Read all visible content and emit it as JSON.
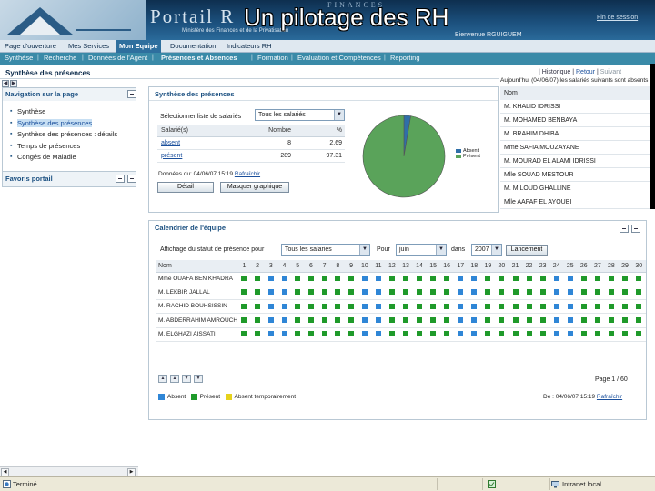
{
  "slide_title": "Un pilotage des RH",
  "banner": {
    "finances": "FINANCES",
    "portal_name": "Portail R",
    "ministry": "Ministère des Finances et de la Privatisation",
    "welcome": "Bienvenue RGUIGUEM",
    "logout": "Fin de session"
  },
  "nav_main": [
    {
      "label": "Page d'ouverture"
    },
    {
      "label": "Mes Services"
    },
    {
      "label": "Mon Equipe",
      "active": true
    },
    {
      "label": "Documentation"
    },
    {
      "label": "Indicateurs RH"
    }
  ],
  "nav_sub": [
    {
      "label": "Synthèse"
    },
    {
      "label": "Recherche"
    },
    {
      "label": "Données de l'Agent"
    },
    {
      "label": "Présences et Absences",
      "active": true
    },
    {
      "label": "Formation"
    },
    {
      "label": "Evaluation et Compétences"
    },
    {
      "label": "Reporting"
    }
  ],
  "page": {
    "title": "Synthèse des présences",
    "history": "Historique",
    "back": "Retour",
    "next": "Suivant"
  },
  "left_nav": {
    "title": "Navigation sur la page",
    "items": [
      {
        "label": "Synthèse"
      },
      {
        "label": "Synthèse des présences",
        "selected": true
      },
      {
        "label": "Synthèse des présences : détails"
      },
      {
        "label": "Temps de présences"
      },
      {
        "label": "Congés de Maladie"
      }
    ],
    "favorites": "Favoris portail"
  },
  "synthesis": {
    "title": "Synthèse des présences",
    "select_label": "Sélectionner liste de salariés",
    "select_value": "Tous les salariés",
    "columns": [
      "Salarié(s)",
      "Nombre",
      "%"
    ],
    "rows": [
      {
        "label": "absent",
        "count": "8",
        "pct": "2.69"
      },
      {
        "label": "présent",
        "count": "289",
        "pct": "97.31"
      }
    ],
    "date_text": "Données du: 04/06/07  15:19",
    "refresh": "Rafraîchir",
    "detail_button": "Détail",
    "hide_button": "Masquer graphique",
    "legend": [
      {
        "label": "Absent",
        "color": "#2f6fa8"
      },
      {
        "label": "Présent",
        "color": "#5aa35a"
      }
    ]
  },
  "chart_data": {
    "type": "pie",
    "categories": [
      "Absent",
      "Présent"
    ],
    "values": [
      2.69,
      97.31
    ],
    "colors": [
      "#2f6fa8",
      "#5aa35a"
    ]
  },
  "overlay": {
    "heading": "Aujourd'hui (04/06/07) les salariés suivants sont absents",
    "column": "Nom",
    "names": [
      "M. KHALID IDRISSI",
      "M. MOHAMED BENBAYA",
      "M. BRAHIM DHIBA",
      "Mme SAFIA MOUZAYANE",
      "M. MOURAD EL ALAMI IDRISSI",
      "Mlle SOUAD MESTOUR",
      "M. MILOUD GHALLINE",
      "Mlle AAFAF EL AYOUBI"
    ]
  },
  "calendar": {
    "title": "Calendrier de l'équipe",
    "status_label": "Affichage du statut de présence pour",
    "who_value": "Tous les salariés",
    "for_label": "Pour",
    "month_value": "juin",
    "in_label": "dans",
    "year_value": "2007",
    "launch_button": "Lancement",
    "name_col": "Nom",
    "days": [
      "1",
      "2",
      "3",
      "4",
      "5",
      "6",
      "7",
      "8",
      "9",
      "10",
      "11",
      "12",
      "13",
      "14",
      "15",
      "16",
      "17",
      "18",
      "19",
      "20",
      "21",
      "22",
      "23",
      "24",
      "25",
      "26",
      "27",
      "28",
      "29",
      "30"
    ],
    "employees": [
      {
        "name": "Mme OUAFA BEN KHADRA",
        "row": "GGBBGGGGGBBGGGGGBBGGGGGBBGGGGGB"
      },
      {
        "name": "M. LEKBIR JALLAL",
        "row": "GGBBGGGGGBBGGGGGBBGGGGGBBGGGGGB"
      },
      {
        "name": "M. RACHID BOUHSISSIN",
        "row": "GGBBGGGGGBBGGGGGBBGGGGGBBGGGGGB"
      },
      {
        "name": "M. ABDERRAHIM AMROUCH",
        "row": "GGBBGGGGGBBGGGGGBBGGGGGBBGGGGGB"
      },
      {
        "name": "M. ELGHAZI AISSATI",
        "row": "GGBBGGGGGBBGGGGGBBGGGGGBBGGGGGB"
      }
    ],
    "page_info": "Page 1 / 60",
    "legend": [
      {
        "label": "Absent",
        "color": "#2f86d6"
      },
      {
        "label": "Présent",
        "color": "#1f9a2a"
      },
      {
        "label": "Absent temporairement",
        "color": "#e6d21c"
      }
    ],
    "date_text": "De : 04/06/07  15:19",
    "refresh": "Rafraîchir"
  },
  "status_bar": {
    "done": "Terminé",
    "zone": "Intranet local"
  }
}
